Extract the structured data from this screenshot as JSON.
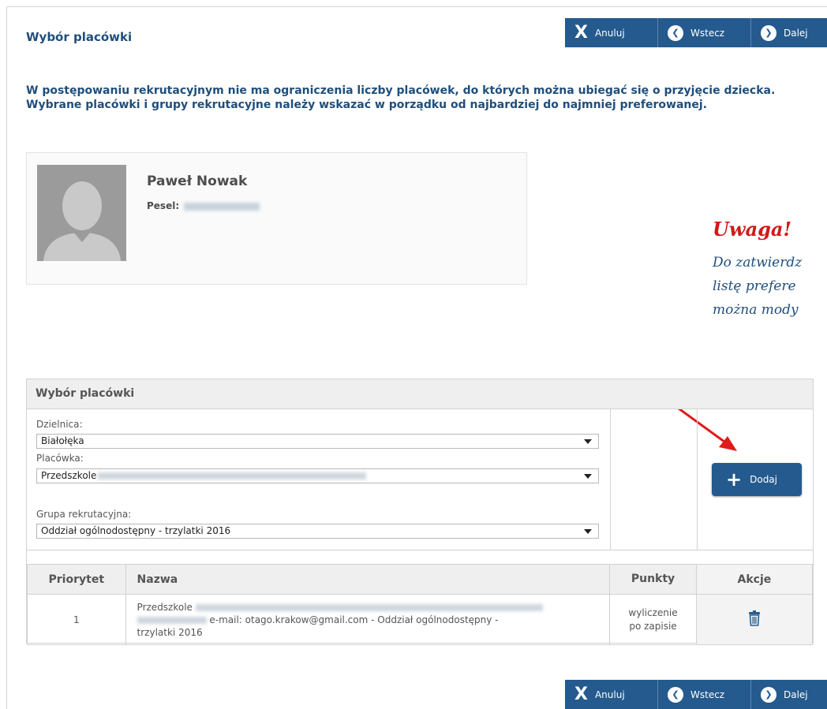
{
  "toolbar": {
    "cancel_label": "Anuluj",
    "back_label": "Wstecz",
    "next_label": "Dalej"
  },
  "page": {
    "title": "Wybór placówki",
    "intro": "W postępowaniu rekrutacyjnym nie ma ograniczenia liczby placówek, do których można ubiegać się o przyjęcie dziecka. Wybrane placówki i grupy rekrutacyjne należy wskazać w porządku od najbardziej do najmniej preferowanej."
  },
  "child": {
    "name": "Paweł Nowak",
    "pesel_label": "Pesel:"
  },
  "warning": {
    "title": "Uwaga!",
    "lines": [
      "Do zatwierdz",
      "listę prefere",
      "można mody"
    ]
  },
  "panel": {
    "title": "Wybór placówki",
    "district_label": "Dzielnica:",
    "district_value": "Białołęka",
    "facility_label": "Placówka:",
    "facility_value": "Przedszkole",
    "group_label": "Grupa rekrutacyjna:",
    "group_value": "Oddział ogólnodostępny - trzylatki 2016",
    "add_label": "Dodaj"
  },
  "table": {
    "headers": [
      "Priorytet",
      "Nazwa",
      "Punkty",
      "Akcje"
    ],
    "rows": [
      {
        "priority": "1",
        "name_prefix": "Przedszkole",
        "name_email": "e-mail: otago.krakow@gmail.com - Oddział ogólnodostępny -",
        "name_suffix": "trzylatki 2016",
        "points_line1": "wyliczenie",
        "points_line2": "po zapisie"
      }
    ]
  },
  "colors": {
    "toolbar_bg": "#245a8e",
    "heading": "#1f4e7c",
    "warning": "#d41818",
    "arrow": "#e01b1b"
  },
  "icons": [
    "close-icon",
    "arrow-left-circle-icon",
    "arrow-right-circle-icon",
    "plus-icon",
    "trash-icon",
    "avatar-placeholder",
    "annotation-arrow"
  ]
}
